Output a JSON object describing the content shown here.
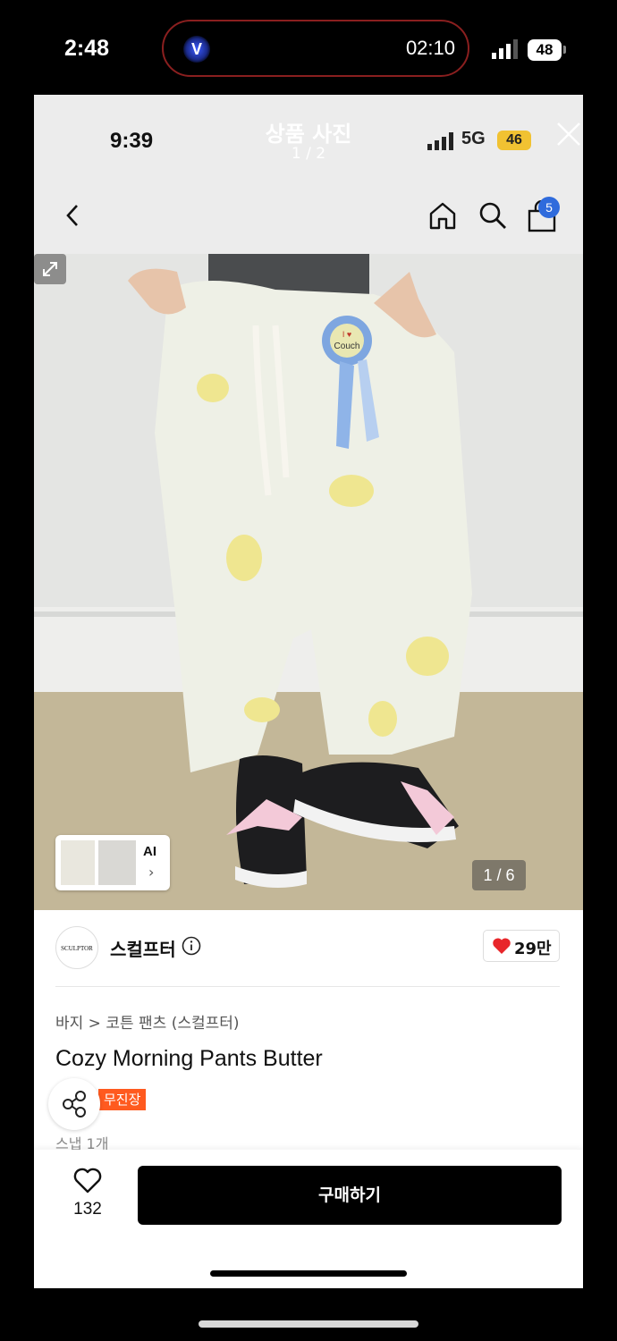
{
  "outer_status": {
    "time": "2:48",
    "recording_timer": "02:10",
    "battery": "48",
    "app_icon": "V"
  },
  "inner_status": {
    "time": "9:39",
    "network": "5G",
    "battery": "46"
  },
  "header": {
    "title": "상품 사진",
    "counter": "1 / 2"
  },
  "nav": {
    "cart_badge": "5"
  },
  "photo": {
    "ribbon_text_top": "I ♥",
    "ribbon_text_bottom": "Couch",
    "thumb_label": "AI",
    "thumb_chevron": "›",
    "image_counter": "1 / 6"
  },
  "seller": {
    "logo_text": "SCULPTOR",
    "name": "스컬프터",
    "likes": "29만"
  },
  "product": {
    "breadcrumb": "바지 > 코튼 팬츠 (스컬프터)",
    "name": "Cozy Morning Pants Butter",
    "tag": "무진장",
    "snap": "스냅 1개"
  },
  "bottom": {
    "wish_count": "132",
    "buy_label": "구매하기"
  },
  "colors": {
    "accent_blue": "#2f6bdc",
    "tag_orange": "#ff5a1f",
    "like_red": "#e8262a",
    "inner_battery": "#f1c232"
  }
}
